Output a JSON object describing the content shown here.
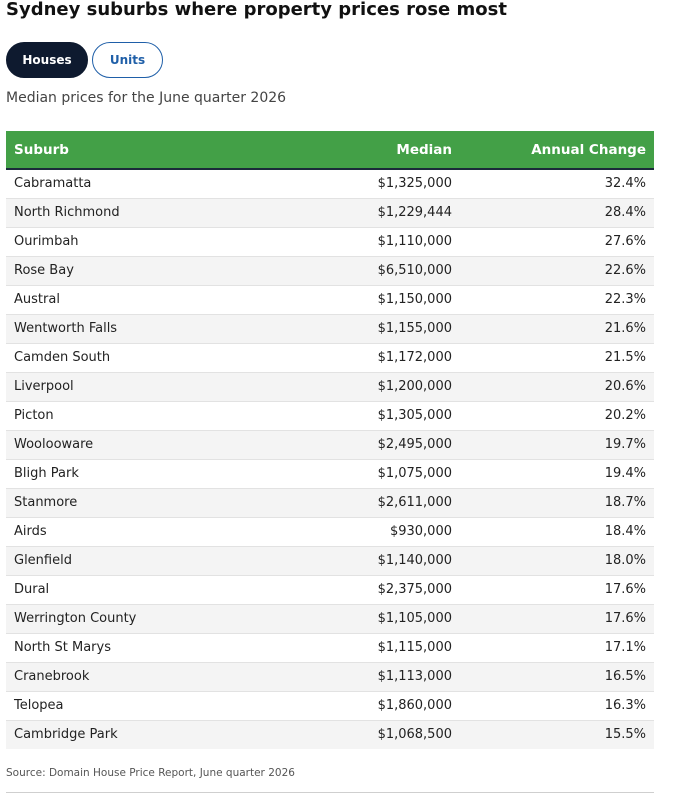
{
  "title": "Sydney suburbs where property prices rose most",
  "toggles": {
    "houses_label": "Houses",
    "units_label": "Units",
    "active": "Houses"
  },
  "subtitle": "Median prices for the June quarter 2026",
  "table": {
    "headers": {
      "suburb": "Suburb",
      "median": "Median",
      "change": "Annual Change"
    },
    "rows": [
      {
        "suburb": "Cabramatta",
        "median": "$1,325,000",
        "change": "32.4%"
      },
      {
        "suburb": "North Richmond",
        "median": "$1,229,444",
        "change": "28.4%"
      },
      {
        "suburb": "Ourimbah",
        "median": "$1,110,000",
        "change": "27.6%"
      },
      {
        "suburb": "Rose Bay",
        "median": "$6,510,000",
        "change": "22.6%"
      },
      {
        "suburb": "Austral",
        "median": "$1,150,000",
        "change": "22.3%"
      },
      {
        "suburb": "Wentworth Falls",
        "median": "$1,155,000",
        "change": "21.6%"
      },
      {
        "suburb": "Camden South",
        "median": "$1,172,000",
        "change": "21.5%"
      },
      {
        "suburb": "Liverpool",
        "median": "$1,200,000",
        "change": "20.6%"
      },
      {
        "suburb": "Picton",
        "median": "$1,305,000",
        "change": "20.2%"
      },
      {
        "suburb": "Woolooware",
        "median": "$2,495,000",
        "change": "19.7%"
      },
      {
        "suburb": "Bligh Park",
        "median": "$1,075,000",
        "change": "19.4%"
      },
      {
        "suburb": "Stanmore",
        "median": "$2,611,000",
        "change": "18.7%"
      },
      {
        "suburb": "Airds",
        "median": "$930,000",
        "change": "18.4%"
      },
      {
        "suburb": "Glenfield",
        "median": "$1,140,000",
        "change": "18.0%"
      },
      {
        "suburb": "Dural",
        "median": "$2,375,000",
        "change": "17.6%"
      },
      {
        "suburb": "Werrington County",
        "median": "$1,105,000",
        "change": "17.6%"
      },
      {
        "suburb": "North St Marys",
        "median": "$1,115,000",
        "change": "17.1%"
      },
      {
        "suburb": "Cranebrook",
        "median": "$1,113,000",
        "change": "16.5%"
      },
      {
        "suburb": "Telopea",
        "median": "$1,860,000",
        "change": "16.3%"
      },
      {
        "suburb": "Cambridge Park",
        "median": "$1,068,500",
        "change": "15.5%"
      }
    ]
  },
  "source": "Source: Domain House Price Report, June quarter 2026",
  "colors": {
    "header_green": "#43a047",
    "active_toggle": "#0e1a2f",
    "inactive_toggle_text": "#1f5fa8"
  }
}
